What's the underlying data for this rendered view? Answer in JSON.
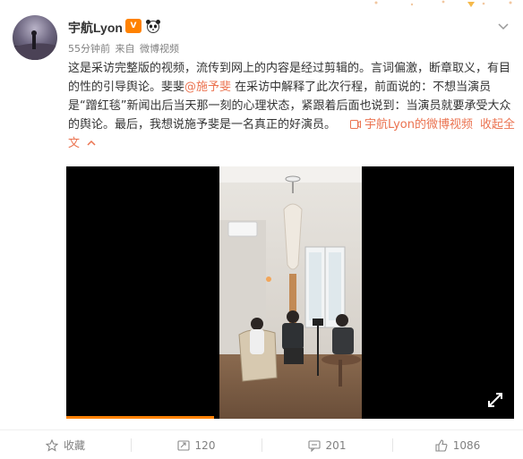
{
  "post": {
    "username": "宇航Lyon",
    "vip_badge": "V",
    "time": "55分钟前",
    "source_prefix": "来自",
    "source": "微博视频",
    "text_part1": "这是采访完整版的视频，流传到网上的内容是经过剪辑的。言词偏激，断章取义，有目的性的引导舆论。斐斐",
    "mention": "@施予斐",
    "text_part2": " 在采访中解释了此次行程，前面说的：不想当演员是“蹭红毯”新闻出后当天那一刻的心理状态，紧跟着后面也说到：当演员就要承受大众的舆论。最后，我想说施予斐是一名真正的好演员。",
    "video_link": "宇航Lyon的微博视频",
    "collapse": "收起全文",
    "collapse_icon": "chevron-up-icon"
  },
  "video": {
    "progress_percent": 33
  },
  "footer": {
    "favorite_label": "收藏",
    "repost_count": "120",
    "comment_count": "201",
    "like_count": "1086"
  },
  "colors": {
    "accent": "#eb7350",
    "progress": "#ff8200",
    "muted": "#808080"
  }
}
